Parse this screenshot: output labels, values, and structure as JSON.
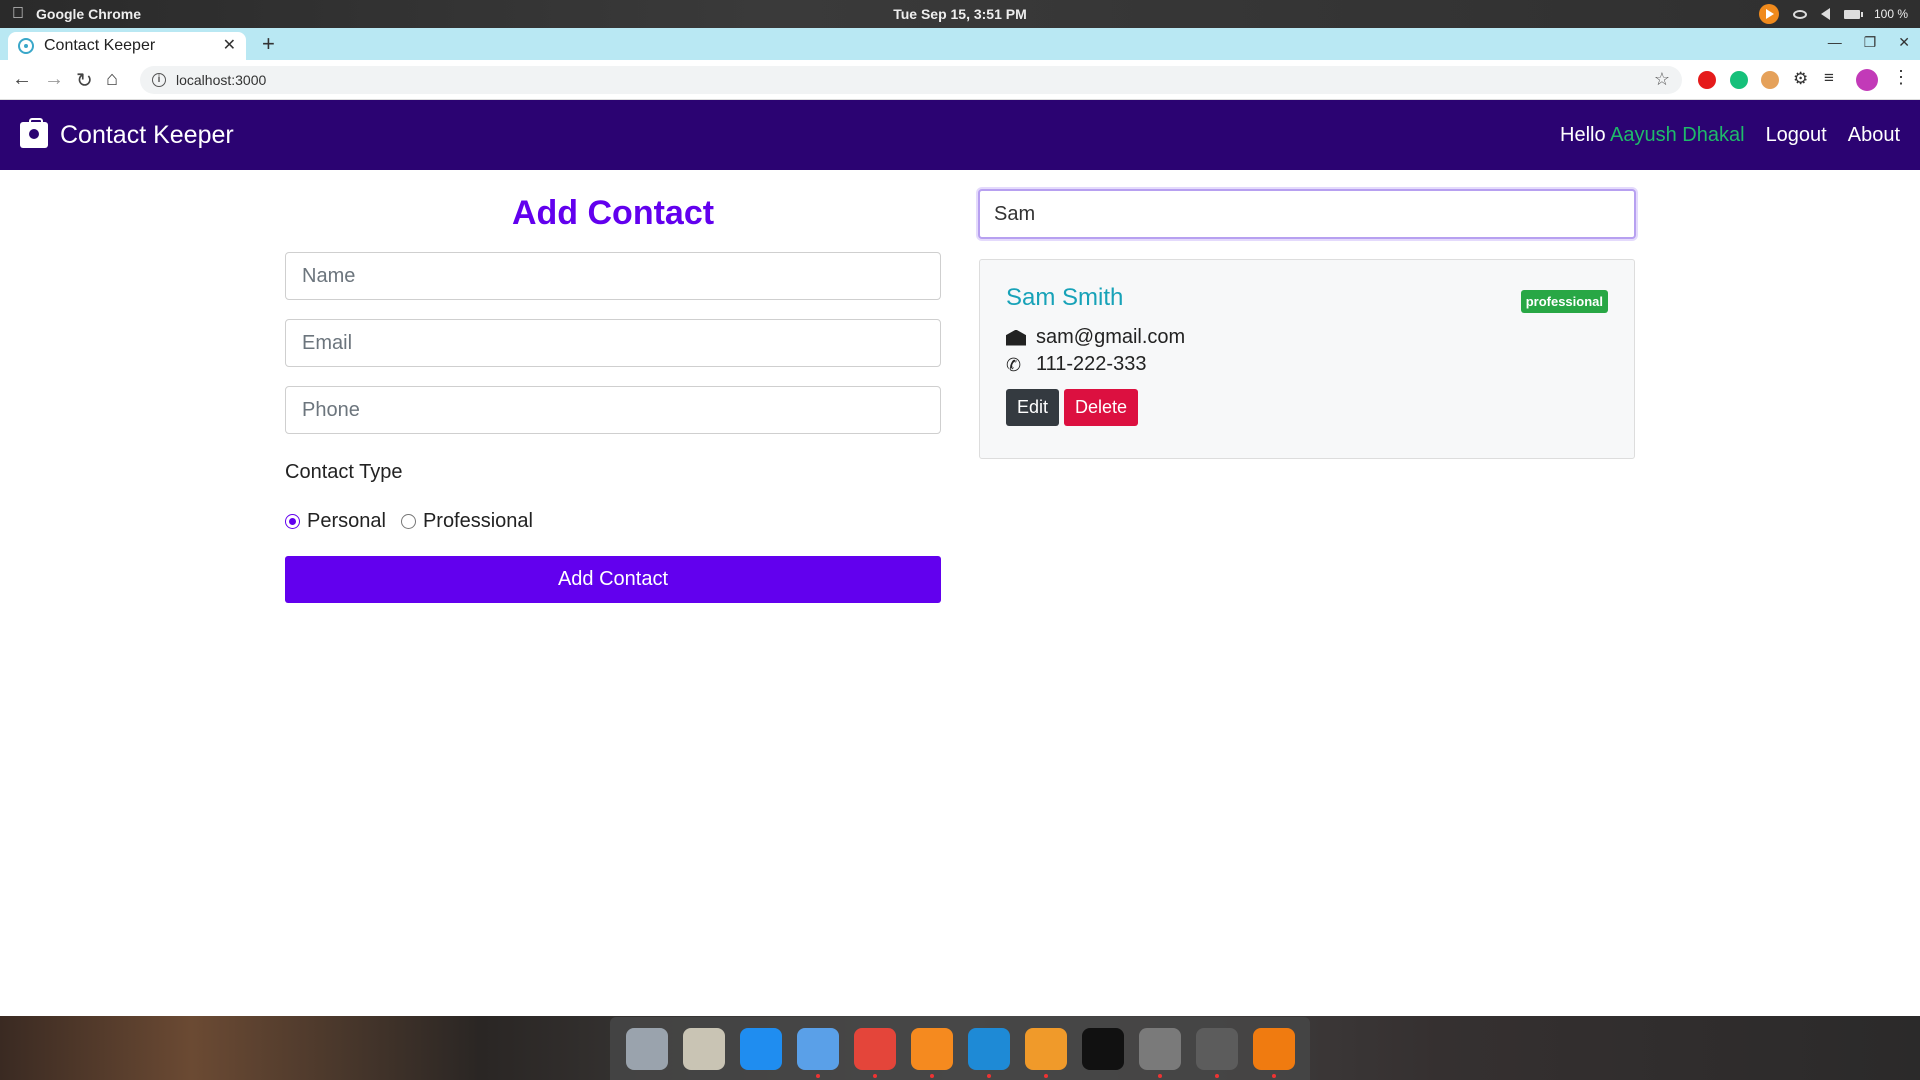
{
  "os": {
    "app_name": "Google Chrome",
    "clock": "Tue Sep 15,  3:51 PM",
    "battery": "100 %"
  },
  "browser": {
    "tab_title": "Contact Keeper",
    "url": "localhost:3000"
  },
  "navbar": {
    "brand": "Contact Keeper",
    "greeting": "Hello",
    "user_name": "Aayush Dhakal",
    "logout_label": "Logout",
    "about_label": "About",
    "bg_color": "#2b0372",
    "user_name_color": "#1fba6a"
  },
  "form": {
    "title": "Add Contact",
    "name_placeholder": "Name",
    "email_placeholder": "Email",
    "phone_placeholder": "Phone",
    "contact_type_label": "Contact Type",
    "options": [
      {
        "label": "Personal",
        "checked": true
      },
      {
        "label": "Professional",
        "checked": false
      }
    ],
    "submit_label": "Add Contact",
    "accent_color": "#6200ee"
  },
  "filter": {
    "value": "Sam"
  },
  "contacts": [
    {
      "name": "Sam Smith",
      "type": "professional",
      "email": "sam@gmail.com",
      "phone": "111-222-333",
      "edit_label": "Edit",
      "delete_label": "Delete"
    }
  ],
  "dock": {
    "apps": [
      {
        "name": "launchpad-icon",
        "color": "#9aa3ad"
      },
      {
        "name": "keychain-icon",
        "color": "#c9c4b4"
      },
      {
        "name": "app-store-icon",
        "color": "#1f8df0"
      },
      {
        "name": "finder-icon",
        "color": "#5aa0e8"
      },
      {
        "name": "chrome-icon",
        "color": "#e4453a"
      },
      {
        "name": "firefox-icon",
        "color": "#f58a1f"
      },
      {
        "name": "vscode-icon",
        "color": "#1e8ad6"
      },
      {
        "name": "sublime-icon",
        "color": "#f09a2a"
      },
      {
        "name": "terminal-icon",
        "color": "#111111"
      },
      {
        "name": "system-prefs-icon",
        "color": "#7a7a7a"
      },
      {
        "name": "settings-icon",
        "color": "#5c5c5c"
      },
      {
        "name": "vlc-icon",
        "color": "#f07b10"
      }
    ]
  }
}
